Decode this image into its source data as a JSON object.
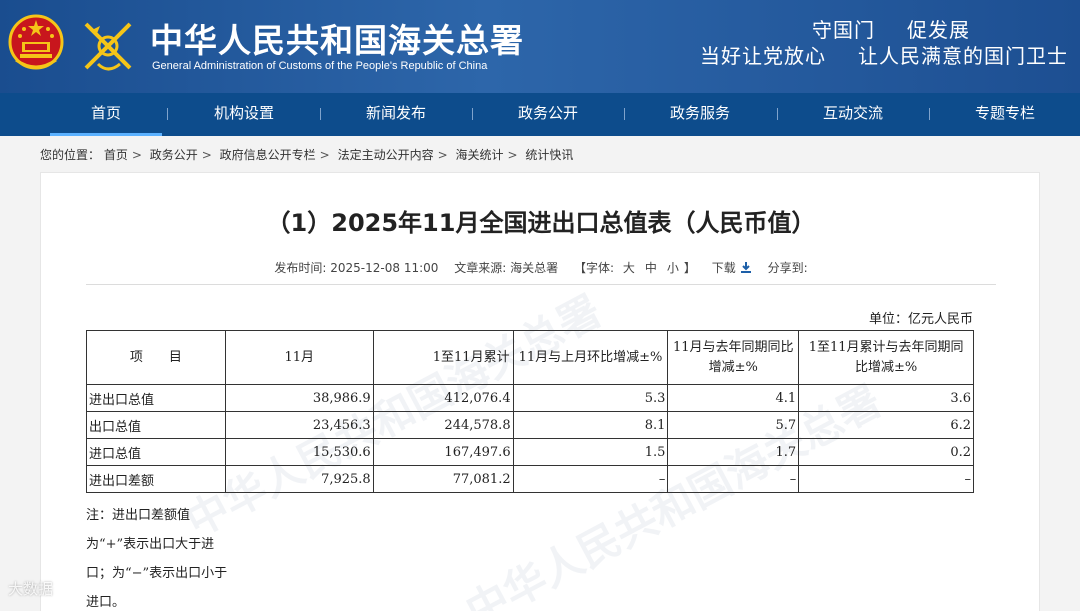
{
  "header": {
    "title_cn": "中华人民共和国海关总署",
    "title_en": "General Administration of Customs of the People's Republic of China",
    "slogan_line1": [
      "守国门",
      "促发展"
    ],
    "slogan_line2": [
      "当好让党放心",
      "让人民满意的国门卫士"
    ],
    "emblem_icon": "national-emblem-icon",
    "logo_icon": "customs-logo-icon"
  },
  "nav": {
    "items": [
      "首页",
      "机构设置",
      "新闻发布",
      "政务公开",
      "政务服务",
      "互动交流",
      "专题专栏"
    ],
    "active_index": 0
  },
  "breadcrumb": {
    "prefix": "您的位置：",
    "items": [
      "首页",
      "政务公开",
      "政府信息公开专栏",
      "法定主动公开内容",
      "海关统计",
      "统计快讯"
    ],
    "separator": ">"
  },
  "article": {
    "title": "（1）2025年11月全国进出口总值表（人民币值）",
    "meta": {
      "publish_label": "发布时间:",
      "publish_time": "2025-12-08 11:00",
      "source_label": "文章来源:",
      "source": "海关总署",
      "font_label": "【字体:",
      "font_sizes": [
        "大",
        "中",
        "小"
      ],
      "font_close": "】",
      "download_label": "下载",
      "share_label": "分享到:"
    },
    "unit": "单位：亿元人民币",
    "table": {
      "headers": [
        "项　　目",
        "11月",
        "1至11月累计",
        "11月与上月环比增减±%",
        "11月与去年同期同比增减±%",
        "1至11月累计与去年同期同比增减±%"
      ],
      "rows": [
        [
          "进出口总值",
          "38,986.9",
          "412,076.4",
          "5.3",
          "4.1",
          "3.6"
        ],
        [
          "出口总值",
          "23,456.3",
          "244,578.8",
          "8.1",
          "5.7",
          "6.2"
        ],
        [
          "进口总值",
          "15,530.6",
          "167,497.6",
          "1.5",
          "1.7",
          "0.2"
        ],
        [
          "进出口差额",
          "7,925.8",
          "77,081.2",
          "–",
          "–",
          "–"
        ]
      ]
    },
    "note": "注：进出口差额值为“+”表示出口大于进口；为“−”表示出口小于进口。",
    "watermark_text": "中华人民共和国海关总署"
  },
  "overlay_watermark": "大数据",
  "colors": {
    "header_bg": "#1a4d8f",
    "nav_bg": "#0d4c8c",
    "active_tab_underline": "#5bb1ff",
    "emblem_red": "#c8161d",
    "emblem_gold": "#f5c518"
  }
}
